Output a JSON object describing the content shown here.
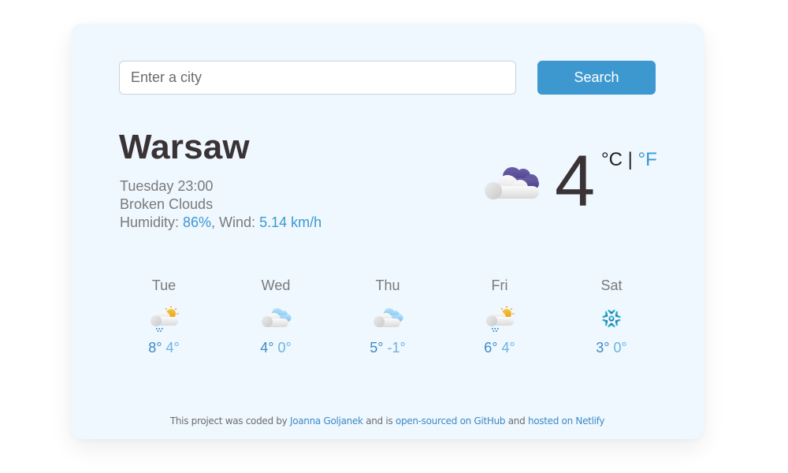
{
  "search": {
    "placeholder": "Enter a city",
    "value": "",
    "button_label": "Search"
  },
  "current": {
    "city": "Warsaw",
    "datetime": "Tuesday 23:00",
    "description": "Broken Clouds",
    "humidity_label": "Humidity: ",
    "humidity": "86%",
    "wind_label": ", Wind: ",
    "wind": "5.14 km/h",
    "icon": "broken-clouds-night-icon",
    "temperature": "4",
    "unit_celsius": "°C",
    "unit_separator": " | ",
    "unit_fahrenheit": "°F"
  },
  "forecast": [
    {
      "day": "Tue",
      "icon": "rain-sun-icon",
      "max": "8°",
      "min": "4°"
    },
    {
      "day": "Wed",
      "icon": "clouds-icon",
      "max": "4°",
      "min": "0°"
    },
    {
      "day": "Thu",
      "icon": "clouds-icon",
      "max": "5°",
      "min": "-1°"
    },
    {
      "day": "Fri",
      "icon": "rain-sun-icon",
      "max": "6°",
      "min": "4°"
    },
    {
      "day": "Sat",
      "icon": "snow-icon",
      "max": "3°",
      "min": "0°"
    }
  ],
  "footer": {
    "text1": "This project was coded by ",
    "author_link": "Joanna Goljanek",
    "text2": " and is ",
    "github_link": "open-sourced on GitHub",
    "text3": " and ",
    "netlify_link": "hosted on Netlify"
  },
  "colors": {
    "accent": "#3d98d0",
    "card_bg": "#eff7ff",
    "text_dark": "#3a3335",
    "text_muted": "#7a7a7a"
  }
}
